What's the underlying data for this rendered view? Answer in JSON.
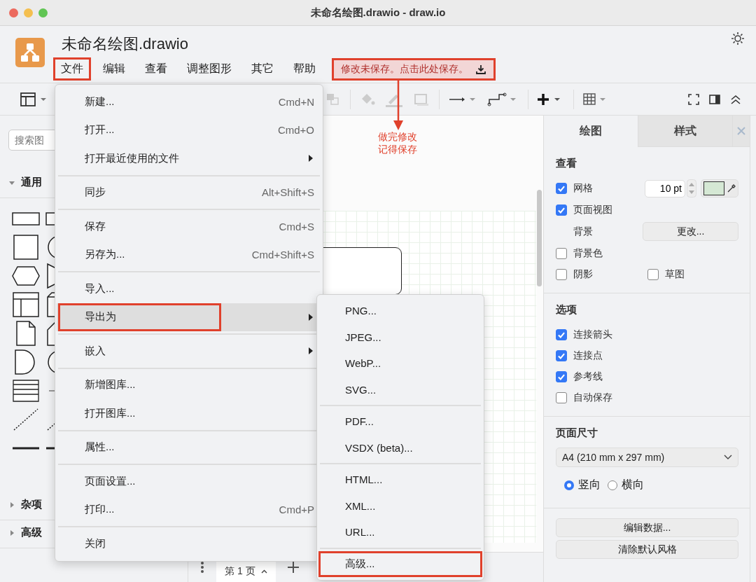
{
  "window": {
    "title": "未命名绘图.drawio - draw.io"
  },
  "header": {
    "file_name": "未命名绘图.drawio",
    "menubar": [
      {
        "label": "文件",
        "annotated": true
      },
      {
        "label": "编辑",
        "annotated": false
      },
      {
        "label": "查看",
        "annotated": false
      },
      {
        "label": "调整图形",
        "annotated": false
      },
      {
        "label": "其它",
        "annotated": false
      },
      {
        "label": "帮助",
        "annotated": false
      }
    ],
    "unsaved_notice": {
      "label": "修改未保存。点击此处保存。",
      "annotated": true
    }
  },
  "annotation": {
    "lines": [
      "做完修改",
      "记得保存"
    ]
  },
  "sidebar": {
    "search": {
      "placeholder": "搜索图"
    },
    "sections": [
      {
        "label": "通用",
        "expanded": true
      },
      {
        "label": "杂项",
        "expanded": false
      },
      {
        "label": "高级",
        "expanded": false
      }
    ]
  },
  "file_menu": [
    {
      "kind": "item",
      "label": "新建...",
      "shortcut": "Cmd+N",
      "submenu": false,
      "selected": false,
      "annotated": false
    },
    {
      "kind": "item",
      "label": "打开...",
      "shortcut": "Cmd+O",
      "submenu": false,
      "selected": false,
      "annotated": false
    },
    {
      "kind": "item",
      "label": "打开最近使用的文件",
      "submenu": true,
      "selected": false,
      "annotated": false
    },
    {
      "kind": "separator"
    },
    {
      "kind": "item",
      "label": "同步",
      "shortcut": "Alt+Shift+S",
      "submenu": false,
      "selected": false,
      "annotated": false
    },
    {
      "kind": "separator"
    },
    {
      "kind": "item",
      "label": "保存",
      "shortcut": "Cmd+S",
      "submenu": false,
      "selected": false,
      "annotated": false
    },
    {
      "kind": "item",
      "label": "另存为...",
      "shortcut": "Cmd+Shift+S",
      "submenu": false,
      "selected": false,
      "annotated": false
    },
    {
      "kind": "separator"
    },
    {
      "kind": "item",
      "label": "导入...",
      "submenu": false,
      "selected": false,
      "annotated": false
    },
    {
      "kind": "item",
      "label": "导出为",
      "submenu": true,
      "selected": true,
      "annotated": true
    },
    {
      "kind": "separator"
    },
    {
      "kind": "item",
      "label": "嵌入",
      "submenu": true,
      "selected": false,
      "annotated": false
    },
    {
      "kind": "separator"
    },
    {
      "kind": "item",
      "label": "新增图库...",
      "submenu": false,
      "selected": false,
      "annotated": false
    },
    {
      "kind": "item",
      "label": "打开图库...",
      "submenu": false,
      "selected": false,
      "annotated": false
    },
    {
      "kind": "separator"
    },
    {
      "kind": "item",
      "label": "属性...",
      "submenu": false,
      "selected": false,
      "annotated": false
    },
    {
      "kind": "separator"
    },
    {
      "kind": "item",
      "label": "页面设置...",
      "submenu": false,
      "selected": false,
      "annotated": false
    },
    {
      "kind": "item",
      "label": "打印...",
      "shortcut": "Cmd+P",
      "submenu": false,
      "selected": false,
      "annotated": false
    },
    {
      "kind": "separator"
    },
    {
      "kind": "item",
      "label": "关闭",
      "submenu": false,
      "selected": false,
      "annotated": false
    }
  ],
  "export_menu": [
    {
      "kind": "item",
      "label": "PNG...",
      "annotated": false
    },
    {
      "kind": "item",
      "label": "JPEG...",
      "annotated": false
    },
    {
      "kind": "item",
      "label": "WebP...",
      "annotated": false
    },
    {
      "kind": "item",
      "label": "SVG...",
      "annotated": false
    },
    {
      "kind": "separator"
    },
    {
      "kind": "item",
      "label": "PDF...",
      "annotated": false
    },
    {
      "kind": "item",
      "label": "VSDX (beta)...",
      "annotated": false
    },
    {
      "kind": "separator"
    },
    {
      "kind": "item",
      "label": "HTML...",
      "annotated": false
    },
    {
      "kind": "item",
      "label": "XML...",
      "annotated": false
    },
    {
      "kind": "item",
      "label": "URL...",
      "annotated": false
    },
    {
      "kind": "separator"
    },
    {
      "kind": "item",
      "label": "高级...",
      "annotated": true
    }
  ],
  "page_tabs": [
    {
      "label": "第 1 页",
      "selected": true
    }
  ],
  "format_panel": {
    "tabs": [
      {
        "label": "绘图",
        "selected": true
      },
      {
        "label": "样式",
        "selected": false
      }
    ],
    "view": {
      "title": "查看",
      "grid": {
        "label": "网格",
        "checked": true,
        "size": "10 pt",
        "color": "#d5e8d4"
      },
      "page_view": {
        "label": "页面视图",
        "checked": true
      },
      "background": {
        "label": "背景",
        "button": "更改..."
      },
      "background_color": {
        "label": "背景色",
        "checked": false
      },
      "shadow": {
        "label": "阴影",
        "checked": false
      },
      "sketch": {
        "label": "草图",
        "checked": false
      }
    },
    "options": {
      "title": "选项",
      "items": [
        {
          "label": "连接箭头",
          "checked": true
        },
        {
          "label": "连接点",
          "checked": true
        },
        {
          "label": "参考线",
          "checked": true
        },
        {
          "label": "自动保存",
          "checked": false
        }
      ]
    },
    "page_size": {
      "title": "页面尺寸",
      "value": "A4 (210 mm x 297 mm)",
      "orientations": [
        {
          "label": "竖向",
          "selected": true
        },
        {
          "label": "横向",
          "selected": false
        }
      ]
    },
    "buttons": [
      "编辑数据...",
      "清除默认风格"
    ]
  }
}
